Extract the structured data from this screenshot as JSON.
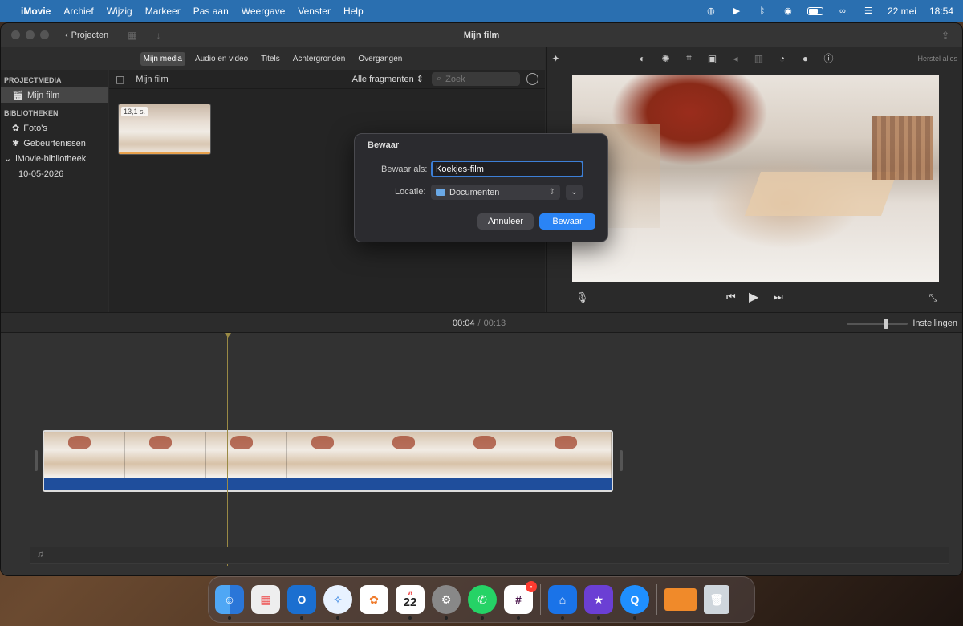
{
  "menubar": {
    "app": "iMovie",
    "items": [
      "Archief",
      "Wijzig",
      "Markeer",
      "Pas aan",
      "Weergave",
      "Venster",
      "Help"
    ],
    "date": "22 mei",
    "time": "18:54"
  },
  "window": {
    "title": "Mijn film",
    "projects_label": "Projecten"
  },
  "tabs": [
    "Mijn media",
    "Audio en video",
    "Titels",
    "Achtergronden",
    "Overgangen"
  ],
  "sidebar": {
    "projectmedia_header": "PROJECTMEDIA",
    "project_item": "Mijn film",
    "libraries_header": "BIBLIOTHEKEN",
    "photos": "Foto's",
    "events": "Gebeurtenissen",
    "library": "iMovie-bibliotheek",
    "event_date": "10-05-2026"
  },
  "browser": {
    "title": "Mijn film",
    "filter": "Alle fragmenten",
    "search_placeholder": "Zoek",
    "clip_duration": "13,1 s."
  },
  "viewer": {
    "reset_label": "Herstel alles"
  },
  "timeline": {
    "current": "00:04",
    "separator": "/",
    "total": "00:13",
    "settings_label": "Instellingen",
    "zoom_level": 0.65
  },
  "dialog": {
    "title": "Bewaar",
    "save_as_label": "Bewaar als:",
    "filename": "Koekjes-film",
    "location_label": "Locatie:",
    "location": "Documenten",
    "cancel": "Annuleer",
    "save": "Bewaar"
  },
  "dock": {
    "calendar_month": "vr",
    "calendar_day": "22",
    "apps": [
      "finder",
      "launchpad",
      "outlook",
      "safari",
      "photos",
      "calendar",
      "system-settings",
      "whatsapp",
      "slack",
      "keynote",
      "imovie",
      "quicktime",
      "preview",
      "trash"
    ]
  },
  "colors": {
    "accent": "#2a84f5",
    "menubar": "#2a6fb0",
    "audio_track": "#1f4e9c",
    "playhead": "#9a8a45"
  }
}
